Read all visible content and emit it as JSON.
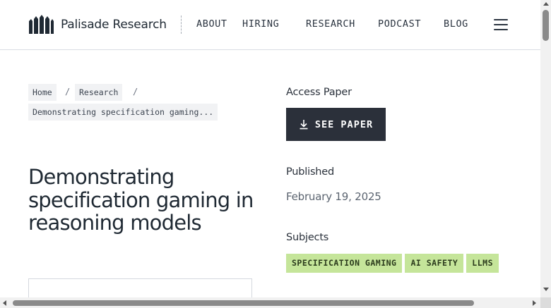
{
  "header": {
    "logo_text": "Palisade Research",
    "logo_icon": "palisade-fence-icon",
    "nav": [
      "ABOUT",
      "HIRING",
      "RESEARCH",
      "PODCAST",
      "BLOG"
    ],
    "menu_icon": "hamburger-menu-icon"
  },
  "breadcrumb": {
    "items": [
      "Home",
      "Research",
      "Demonstrating specification gaming..."
    ],
    "separator": "/"
  },
  "article": {
    "title": "Demonstrating specification gaming in reasoning models"
  },
  "sidebar": {
    "access_label": "Access Paper",
    "see_paper_label": "SEE PAPER",
    "download_icon": "download-icon",
    "published_label": "Published",
    "published_date": "February 19, 2025",
    "subjects_label": "Subjects",
    "subjects": [
      "SPECIFICATION GAMING",
      "AI SAFETY",
      "LLMS"
    ]
  },
  "colors": {
    "button_bg": "#2b303a",
    "tag_bg": "#c5e59a",
    "crumb_bg": "#f1f2f4"
  }
}
